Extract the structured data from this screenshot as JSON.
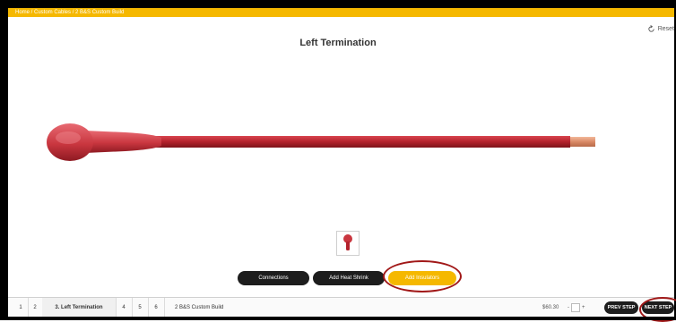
{
  "topbar": {
    "breadcrumb": "Home / Custom Cables / 2 B&S Custom Build"
  },
  "main": {
    "title": "Left Termination",
    "reset_label": "Reset"
  },
  "buttons": {
    "connections": "Connections",
    "add_heat_shrink": "Add Heat Shrink",
    "add_insulators": "Add Insulators"
  },
  "steps": [
    {
      "label": "1"
    },
    {
      "label": "2"
    },
    {
      "label": "3. Left Termination"
    },
    {
      "label": "4"
    },
    {
      "label": "5"
    },
    {
      "label": "6"
    }
  ],
  "product": {
    "name": "2 B&S Custom Build",
    "price": "$60.30",
    "quantity": "1"
  },
  "nav": {
    "prev": "PREV STEP",
    "next": "NEXT STEP"
  },
  "colors": {
    "accent": "#f5b800",
    "cable": "#b3222c",
    "annotation": "#a11818"
  }
}
